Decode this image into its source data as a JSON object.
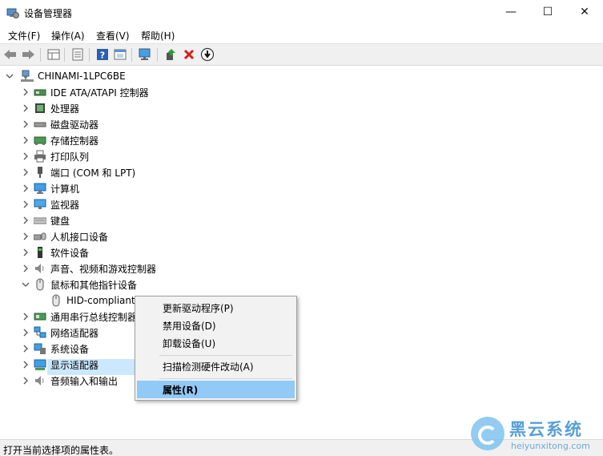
{
  "window": {
    "title": "设备管理器",
    "minimize_glyph": "—",
    "maximize_glyph": "☐",
    "close_glyph": "✕"
  },
  "menu": [
    "文件(F)",
    "操作(A)",
    "查看(V)",
    "帮助(H)"
  ],
  "toolbar": [
    "back-arrow-icon",
    "forward-arrow-icon",
    "properties-grid-icon",
    "view-list-icon",
    "help-icon",
    "properties-icon",
    "monitor-scan-icon",
    "update-driver-icon",
    "uninstall-x-icon",
    "disable-download-icon"
  ],
  "tree": {
    "root": "CHINAMI-1LPC6BE",
    "items": [
      {
        "label": "IDE ATA/ATAPI 控制器",
        "icon": "ide-controller-icon"
      },
      {
        "label": "处理器",
        "icon": "processor-icon"
      },
      {
        "label": "磁盘驱动器",
        "icon": "disk-drive-icon"
      },
      {
        "label": "存储控制器",
        "icon": "storage-controller-icon"
      },
      {
        "label": "打印队列",
        "icon": "printer-icon"
      },
      {
        "label": "端口 (COM 和 LPT)",
        "icon": "port-icon"
      },
      {
        "label": "计算机",
        "icon": "computer-icon"
      },
      {
        "label": "监视器",
        "icon": "monitor-icon"
      },
      {
        "label": "键盘",
        "icon": "keyboard-icon"
      },
      {
        "label": "人机接口设备",
        "icon": "hid-icon"
      },
      {
        "label": "软件设备",
        "icon": "software-device-icon"
      },
      {
        "label": "声音、视频和游戏控制器",
        "icon": "sound-icon"
      },
      {
        "label": "鼠标和其他指针设备",
        "icon": "mouse-icon"
      },
      {
        "label": "HID-compliant",
        "icon": "mouse-icon"
      },
      {
        "label": "通用串行总线控制器",
        "icon": "usb-icon"
      },
      {
        "label": "网络适配器",
        "icon": "network-icon"
      },
      {
        "label": "系统设备",
        "icon": "system-device-icon"
      },
      {
        "label": "显示适配器",
        "icon": "display-adapter-icon"
      },
      {
        "label": "音频输入和输出",
        "icon": "audio-io-icon"
      }
    ]
  },
  "context_menu": {
    "items": [
      "更新驱动程序(P)",
      "禁用设备(D)",
      "卸载设备(U)",
      "扫描检测硬件改动(A)",
      "属性(R)"
    ],
    "highlighted": "属性(R)"
  },
  "status": "打开当前选择项的属性表。",
  "watermark": {
    "title": "黑云系统",
    "url": "heiyunxitong.com"
  },
  "colors": {
    "selection": "#cce8ff",
    "menu_highlight": "#91c9f7",
    "uninstall_red": "#d91e18",
    "watermark_blue": "#3a8fd0"
  }
}
